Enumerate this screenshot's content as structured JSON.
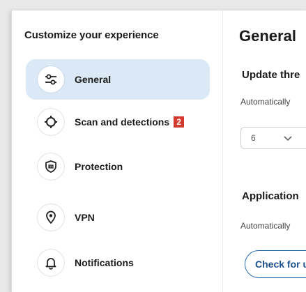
{
  "sidebar": {
    "title": "Customize your experience",
    "items": [
      {
        "label": "General",
        "icon": "sliders-icon",
        "active": true
      },
      {
        "label": "Scan and detections",
        "icon": "crosshair-icon",
        "badge": "2"
      },
      {
        "label": "Protection",
        "icon": "shield-icon"
      },
      {
        "label": "VPN",
        "icon": "location-pin-icon"
      },
      {
        "label": "Notifications",
        "icon": "bell-icon"
      }
    ]
  },
  "main": {
    "title": "General",
    "update_section": {
      "title": "Update thre",
      "desc": "Automatically",
      "select_value": "6"
    },
    "app_section": {
      "title": "Application",
      "desc": "Automatically",
      "button_label": "Check for u"
    }
  },
  "colors": {
    "active_bg": "#dbe9f6",
    "accent": "#2b6cb0",
    "badge": "#d23a2f"
  }
}
